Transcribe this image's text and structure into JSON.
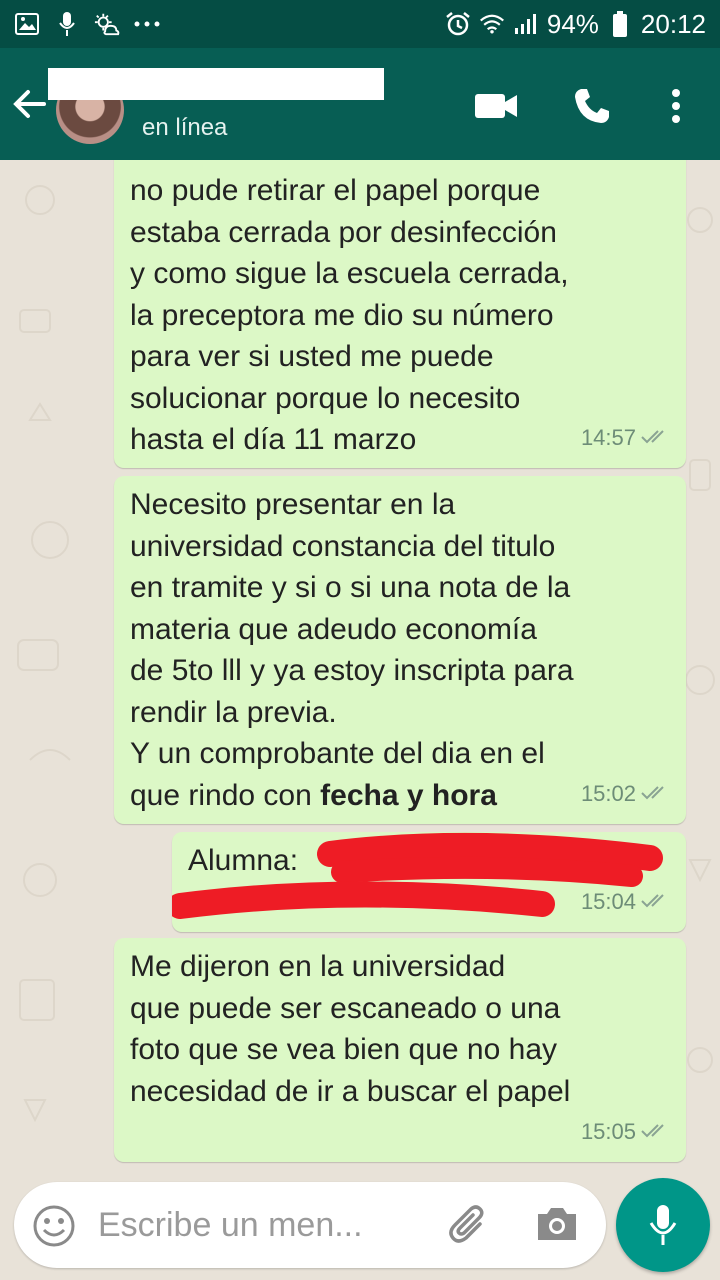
{
  "status_bar": {
    "battery": "94%",
    "time": "20:12",
    "icons": [
      "gallery-icon",
      "mic-icon",
      "weather-icon",
      "more-dots-icon",
      "alarm-icon",
      "wifi-icon",
      "signal-icon",
      "battery-icon"
    ]
  },
  "header": {
    "presence": "en línea",
    "icons": [
      "back-arrow-icon",
      "video-call-icon",
      "phone-call-icon",
      "more-vert-icon"
    ]
  },
  "messages": [
    {
      "text": "no pude retirar el papel porque\nestaba cerrada por desinfección\ny como sigue la escuela cerrada,\nla preceptora me dio su número\npara ver si usted me puede\nsolucionar porque lo necesito\nhasta el día 11 marzo",
      "time": "14:57"
    },
    {
      "text": "Necesito presentar en la\nuniversidad constancia del titulo\nen tramite y si o si una nota de la\nmateria que adeudo economía\nde 5to lll y ya estoy inscripta para\nrendir la previa.\nY un comprobante del dia en el\nque rindo con ",
      "bold": "fecha y hora",
      "time": "15:02"
    },
    {
      "text": "Alumna:",
      "time": "15:04"
    },
    {
      "text": "Me dijeron en la universidad\nque puede ser escaneado o una\nfoto que se vea bien que no hay\nnecesidad de ir a buscar el papel",
      "time": "15:05"
    }
  ],
  "input": {
    "placeholder": "Escribe un men..."
  },
  "colors": {
    "header": "#075e54",
    "status_bar": "#054d44",
    "bubble": "#dcf8c6",
    "mic_button": "#009688",
    "redaction": "#ee1c25"
  }
}
